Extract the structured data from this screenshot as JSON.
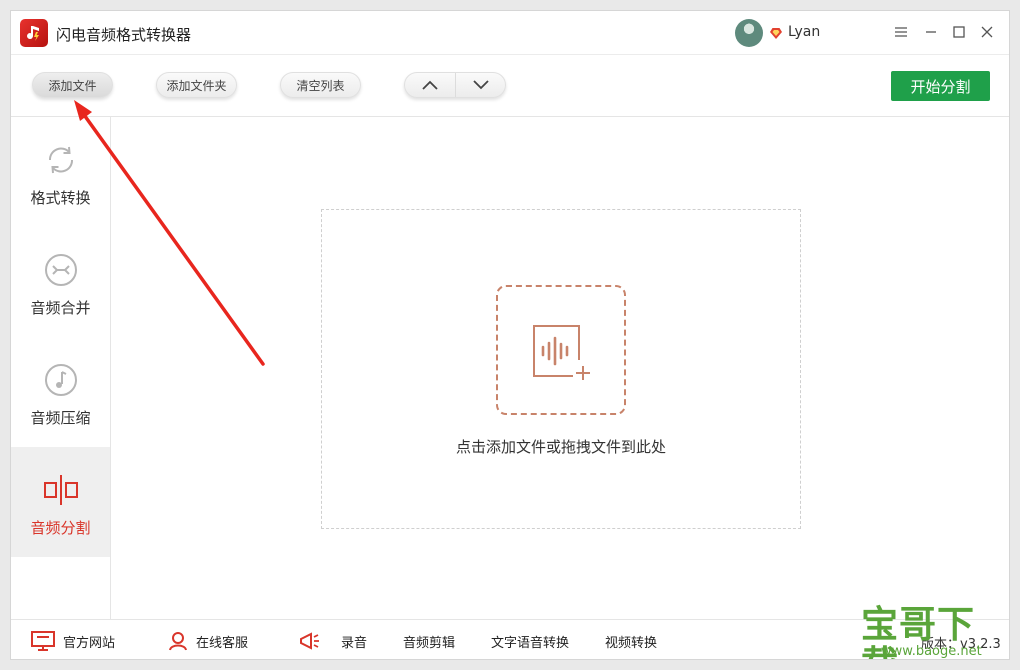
{
  "app": {
    "title": "闪电音频格式转换器",
    "username": "Lyan"
  },
  "toolbar": {
    "add_file": "添加文件",
    "add_folder": "添加文件夹",
    "clear_list": "清空列表",
    "start": "开始分割"
  },
  "sidebar": {
    "items": [
      {
        "label": "格式转换",
        "icon": "refresh-icon"
      },
      {
        "label": "音频合并",
        "icon": "merge-icon"
      },
      {
        "label": "音频压缩",
        "icon": "music-note-icon"
      },
      {
        "label": "音频分割",
        "icon": "split-icon",
        "selected": true
      }
    ]
  },
  "dropzone": {
    "hint": "点击添加文件或拖拽文件到此处"
  },
  "bottom": {
    "website": "官方网站",
    "support": "在线客服",
    "record": "录音",
    "audio_edit": "音频剪辑",
    "tts": "文字语音转换",
    "video": "视频转换",
    "version": "版本：v3.2.3"
  },
  "watermark": {
    "title": "宝哥下载",
    "url": "www.baoge.net"
  },
  "colors": {
    "accent": "#d9352a",
    "start": "#1fa04a",
    "drop": "#c8836a",
    "watermark": "#5aa53a"
  }
}
